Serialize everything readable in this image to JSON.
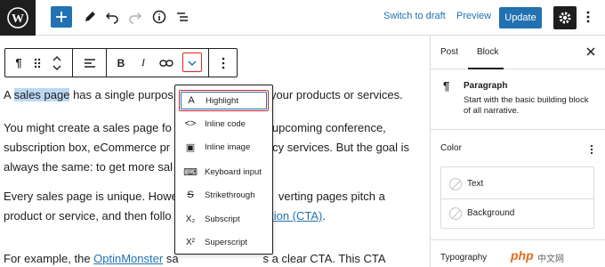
{
  "topbar": {
    "switch_to_draft": "Switch to draft",
    "preview": "Preview",
    "update": "Update",
    "accent_color": "#2271b1"
  },
  "editor": {
    "para1": {
      "before": "A ",
      "highlight": "sales page",
      "middle": " has a single purpos",
      "after": "y your products or services."
    },
    "para2_line1": {
      "a": "You might create a sales page fo",
      "b": "upcoming conference,"
    },
    "para2_line2": {
      "a": "subscription box, eCommerce pr",
      "b": "cy services. But the goal is"
    },
    "para2_line3": {
      "a": "always the same: to get more sal",
      "b": "s."
    },
    "para3_line1": {
      "a": "Every sales page is unique. Howe",
      "b": "verting pages pitch a"
    },
    "para3_line2": {
      "a": "product or service, and then follo",
      "link": "ction (CTA)",
      "b": "."
    },
    "para4": {
      "a": "For example, the ",
      "link": "OptinMonster",
      "b": " sa",
      "c": "s a clear CTA. This CTA"
    }
  },
  "format_menu": {
    "items": [
      {
        "label": "Highlight",
        "icon": "highlight-icon",
        "glyph": "A"
      },
      {
        "label": "Inline code",
        "icon": "code-icon",
        "glyph": "<>"
      },
      {
        "label": "Inline image",
        "icon": "image-icon",
        "glyph": "▣"
      },
      {
        "label": "Keyboard input",
        "icon": "keyboard-icon",
        "glyph": "⌨"
      },
      {
        "label": "Strikethrough",
        "icon": "strikethrough-icon",
        "glyph": "S"
      },
      {
        "label": "Subscript",
        "icon": "subscript-icon",
        "glyph": "X₂"
      },
      {
        "label": "Superscript",
        "icon": "superscript-icon",
        "glyph": "X²"
      }
    ]
  },
  "sidebar": {
    "tabs": [
      "Post",
      "Block"
    ],
    "block_title": "Paragraph",
    "block_desc": "Start with the basic building block of all narrative.",
    "color_section": "Color",
    "color_items": [
      "Text",
      "Background"
    ],
    "typography_section": "Typography"
  },
  "watermark": {
    "logo": "php",
    "text": "中文网"
  }
}
